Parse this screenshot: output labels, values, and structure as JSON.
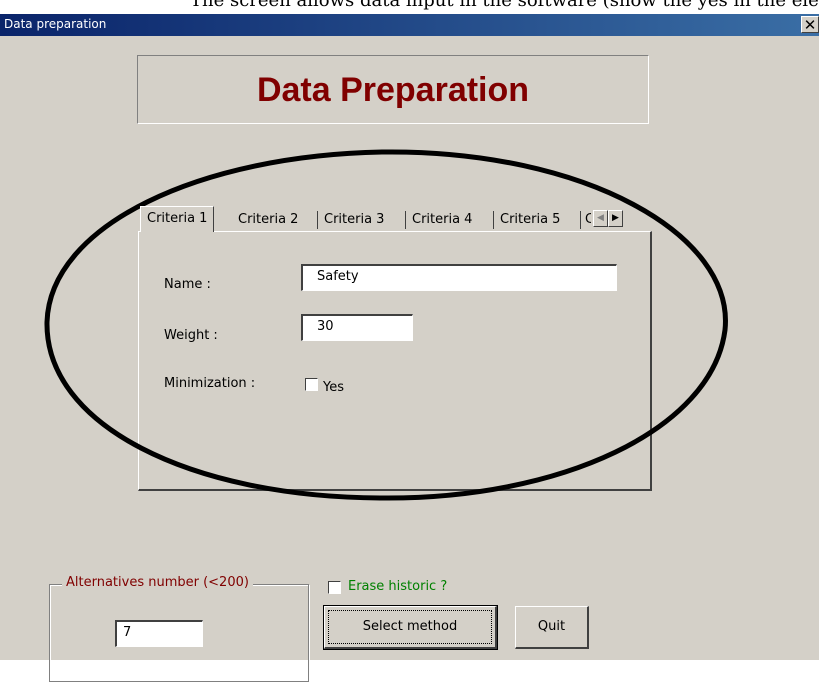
{
  "window": {
    "title": "Data preparation",
    "close_glyph": "✕",
    "caption_above": "The screen allows data input in the software (show the yes in the elements"
  },
  "banner": {
    "title": "Data Preparation",
    "title_color": "#800000"
  },
  "tabs": {
    "items": [
      {
        "label": "Criteria 1",
        "active": true
      },
      {
        "label": "Criteria 2",
        "active": false
      },
      {
        "label": "Criteria 3",
        "active": false
      },
      {
        "label": "Criteria 4",
        "active": false
      },
      {
        "label": "Criteria 5",
        "active": false
      },
      {
        "label": "C",
        "active": false
      }
    ],
    "scroll_left_glyph": "◀",
    "scroll_right_glyph": "▶"
  },
  "criteria_form": {
    "name_label": "Name :",
    "name_value": "Safety",
    "weight_label": "Weight :",
    "weight_value": "30",
    "minimization_label": "Minimization :",
    "minimization_checkbox_label": "Yes",
    "minimization_checked": false
  },
  "alternatives": {
    "group_title": "Alternatives number (<200)",
    "value": "7"
  },
  "erase_historic": {
    "label": "Erase historic ?",
    "checked": false,
    "color": "#008000"
  },
  "buttons": {
    "select_method": "Select method",
    "quit": "Quit"
  },
  "annotation": {
    "shape": "hand-drawn ellipse",
    "color": "#000000"
  }
}
